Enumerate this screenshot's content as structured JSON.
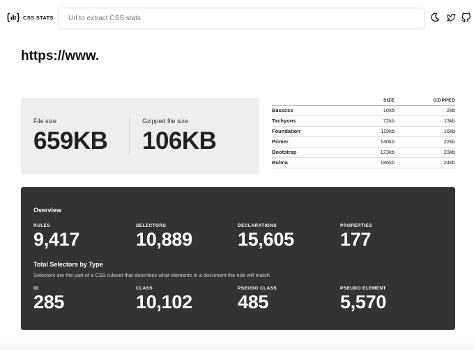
{
  "header": {
    "logo_text": "CSS STATS",
    "search_placeholder": "Url to extract CSS stats"
  },
  "page": {
    "url_title": "https://www."
  },
  "file_size": {
    "label": "File size",
    "value": "659KB",
    "gzip_label": "Gzipped file size",
    "gzip_value": "106KB"
  },
  "comparison": {
    "headers": [
      "SIZE",
      "GZIPPED"
    ],
    "rows": [
      {
        "name": "Basscss",
        "size": "10kb",
        "gzipped": "2kb"
      },
      {
        "name": "Tachyons",
        "size": "72kb",
        "gzipped": "13kb"
      },
      {
        "name": "Foundation",
        "size": "119kb",
        "gzipped": "16kb"
      },
      {
        "name": "Primer",
        "size": "140kb",
        "gzipped": "22kb"
      },
      {
        "name": "Bootstrap",
        "size": "123kb",
        "gzipped": "23kb"
      },
      {
        "name": "Bulma",
        "size": "186kb",
        "gzipped": "24kb"
      }
    ]
  },
  "overview": {
    "title": "Overview",
    "stats": [
      {
        "label": "RULES",
        "value": "9,417"
      },
      {
        "label": "SELECTORS",
        "value": "10,889"
      },
      {
        "label": "DECLARATIONS",
        "value": "15,605"
      },
      {
        "label": "PROPERTIES",
        "value": "177"
      }
    ],
    "selectors_title": "Total Selectors by Type",
    "selectors_desc": "Selectors are the part of a CSS ruleset that describes what elements in a document the rule will match.",
    "selector_types": [
      {
        "label": "ID",
        "value": "285"
      },
      {
        "label": "CLASS",
        "value": "10,102"
      },
      {
        "label": "PSEUDO CLASS",
        "value": "485"
      },
      {
        "label": "PSEUDO ELEMENT",
        "value": "5,570"
      }
    ]
  },
  "icons": [
    "moon-icon",
    "twitter-icon",
    "github-icon"
  ],
  "colors": {
    "panel_light": "#eeeeee",
    "panel_dark": "#333333",
    "text": "#111111"
  }
}
